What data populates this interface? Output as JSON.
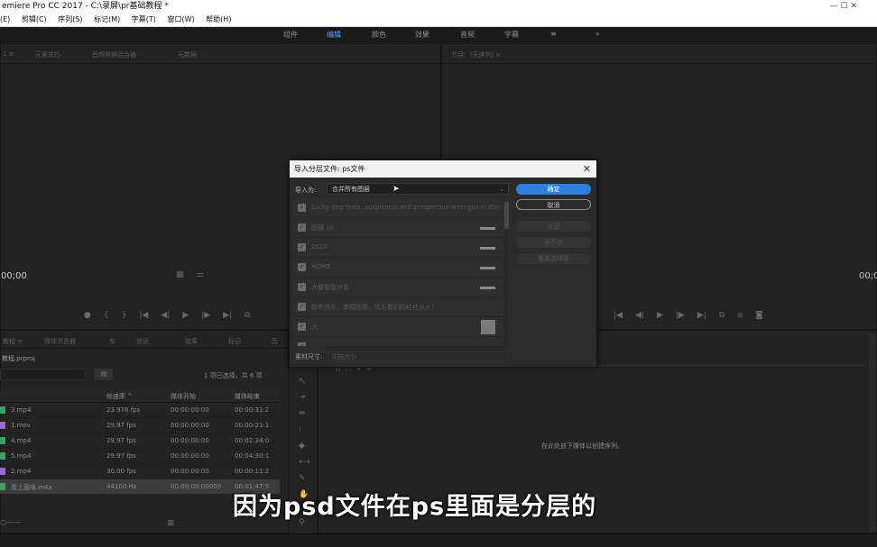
{
  "window": {
    "title": "emiere Pro CC 2017 - C:\\录屏\\pr基础教程 *",
    "controls": "—   ☐   ✕"
  },
  "menu": [
    "(E)",
    "剪辑(C)",
    "序列(S)",
    "标记(M)",
    "字幕(T)",
    "窗口(W)",
    "帮助(H)"
  ],
  "workspaces": [
    "组件",
    "编辑",
    "颜色",
    "效果",
    "音频",
    "字幕",
    "≡",
    "»"
  ],
  "source_panel": {
    "tabs": [
      "1 ≡",
      "元素技巧",
      "音频剪辑混合器",
      "元数据"
    ],
    "timecode": "00;00"
  },
  "program_panel": {
    "tab": "节目：(无序列) ≡",
    "timecode": "00;00"
  },
  "project_panel": {
    "tabs": [
      "教程 ≡",
      "媒体浏览器",
      "库",
      "信息",
      "效果",
      "标记",
      "历"
    ],
    "file": "教程.prproj",
    "selection_info": "1 项已选择，共 6 项",
    "columns": [
      "帧速率 ^",
      "媒体开始",
      "媒体结束"
    ],
    "rows": [
      {
        "name": "3.mp4",
        "fps": "23.976 fps",
        "start": "00:00:00:00",
        "end": "00:00:31:2",
        "type": "video"
      },
      {
        "name": "1.mov",
        "fps": "29.97 fps",
        "start": "00:00:00:00",
        "end": "00:00:21:1",
        "type": "mov"
      },
      {
        "name": "4.mp4",
        "fps": "29.97 fps",
        "start": "00:00:00:00",
        "end": "00:02:34:0",
        "type": "video"
      },
      {
        "name": "5.mp4",
        "fps": "29.97 fps",
        "start": "00:00:00:00",
        "end": "00:04:30:1",
        "type": "video"
      },
      {
        "name": "2.mp4",
        "fps": "30.00 fps",
        "start": "00:00:00:00",
        "end": "00:00:11:2",
        "type": "mov"
      },
      {
        "name": "青上面味.m4a",
        "fps": "44100 Hz",
        "start": "00:00:00:00000",
        "end": "00:01:47:5",
        "type": "audio"
      }
    ]
  },
  "dialog": {
    "title": "导入分层文件: ps文件",
    "import_as_label": "导入为:",
    "import_as_value": "合并所有图层",
    "layers": [
      {
        "name": "Lucky dog feels, auspicious and prosperous arranges in the",
        "thumb": "none"
      },
      {
        "name": "图层 10",
        "thumb": "bar"
      },
      {
        "name": "2020",
        "thumb": "bar"
      },
      {
        "name": "HOME",
        "thumb": "bar"
      },
      {
        "name": "大量智能对象",
        "thumb": "bar"
      },
      {
        "name": "新年快乐，幸福团聚，欢乐我们的红红火火！",
        "thumb": "none"
      },
      {
        "name": "大",
        "thumb": "square"
      },
      {
        "name": "",
        "thumb": "bar"
      }
    ],
    "buttons": {
      "ok": "确定",
      "cancel": "取消",
      "select_all": "全选",
      "select_none": "全不选",
      "reset": "重置选择项"
    },
    "footage_label": "素材尺寸:",
    "footage_value": "文档大小"
  },
  "timeline": {
    "empty_text": "在此处放下媒体以创建序列。"
  },
  "subtitle": "因为psd文件在ps里面是分层的"
}
